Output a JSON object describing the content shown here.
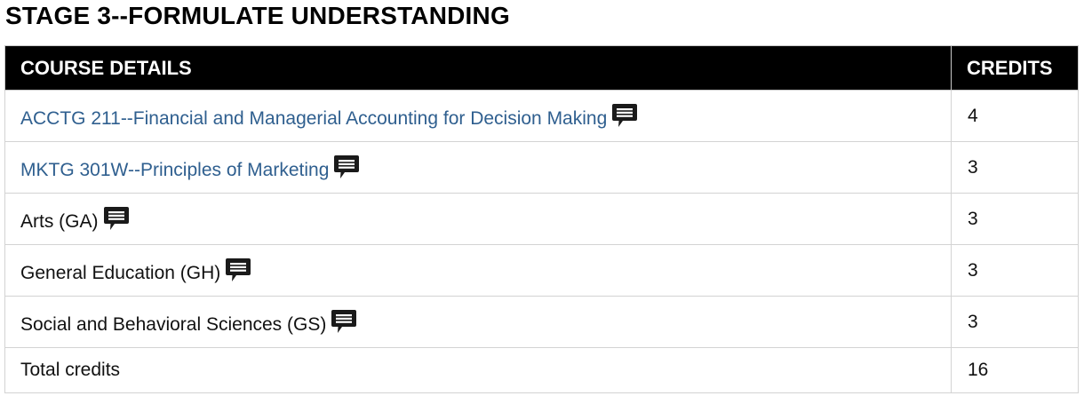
{
  "stage": {
    "title": "STAGE 3--FORMULATE UNDERSTANDING"
  },
  "table": {
    "headers": {
      "details": "COURSE DETAILS",
      "credits": "CREDITS"
    },
    "rows": [
      {
        "label": "ACCTG 211--Financial and Managerial Accounting for Decision Making",
        "credits": "4",
        "is_link": true,
        "icon": "comment-icon"
      },
      {
        "label": "MKTG 301W--Principles of Marketing",
        "credits": "3",
        "is_link": true,
        "icon": "comment-icon"
      },
      {
        "label": "Arts (GA)",
        "credits": "3",
        "is_link": false,
        "icon": "comment-icon"
      },
      {
        "label": "General Education (GH)",
        "credits": "3",
        "is_link": false,
        "icon": "comment-icon"
      },
      {
        "label": "Social and Behavioral Sciences (GS)",
        "credits": "3",
        "is_link": false,
        "icon": "comment-icon"
      }
    ],
    "total": {
      "label": "Total credits",
      "credits": "16"
    }
  },
  "colors": {
    "header_bg": "#000000",
    "header_text": "#ffffff",
    "link": "#2f5f8f",
    "border": "#d3d3d3"
  }
}
